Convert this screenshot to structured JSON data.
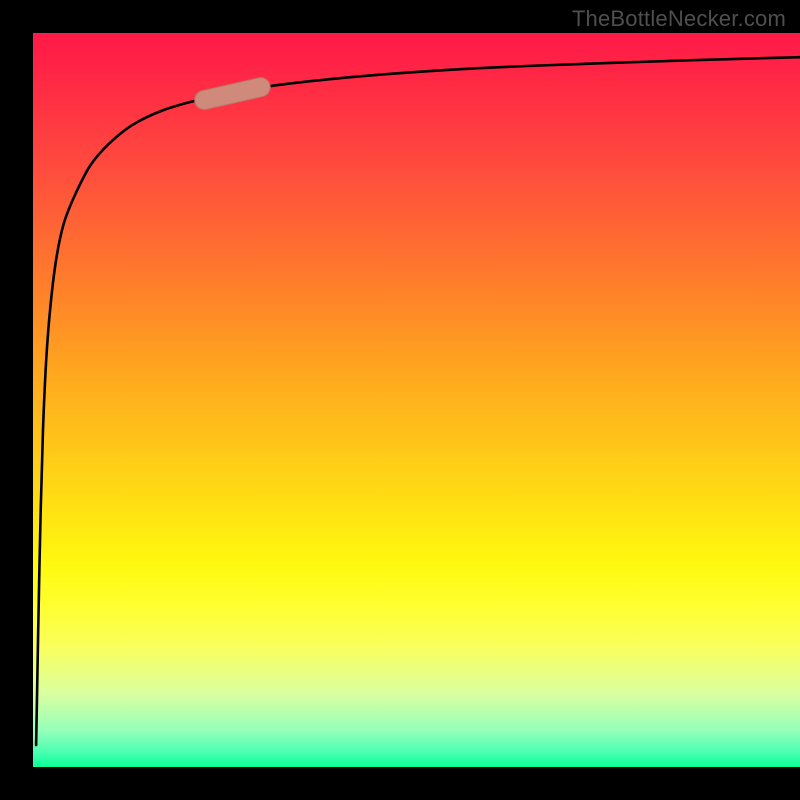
{
  "watermark": "TheBottleNecker.com",
  "colors": {
    "frame": "#000000",
    "curve": "#000000",
    "highlight_fill": "#cf8a7c",
    "highlight_stroke": "#b97768",
    "watermark_text": "#4f4f4f"
  },
  "chart_data": {
    "type": "line",
    "title": "",
    "xlabel": "",
    "ylabel": "",
    "xlim": [
      0,
      100
    ],
    "ylim": [
      0,
      100
    ],
    "series": [
      {
        "name": "bottleneck-curve",
        "x": [
          0.4,
          0.5,
          0.7,
          1.0,
          1.3,
          1.7,
          2.2,
          3.0,
          4.0,
          5.5,
          7.5,
          10,
          13,
          17,
          22,
          28,
          35,
          45,
          58,
          72,
          86,
          100
        ],
        "y": [
          3,
          8,
          20,
          35,
          46,
          55,
          62,
          69,
          74,
          78,
          82,
          85,
          87.5,
          89.5,
          91,
          92.3,
          93.3,
          94.3,
          95.2,
          95.8,
          96.3,
          96.7
        ]
      }
    ],
    "annotations": [
      {
        "name": "highlight-segment",
        "type": "pill",
        "x_range": [
          22,
          30
        ],
        "y_range": [
          90.8,
          92.7
        ]
      }
    ],
    "background_gradient": {
      "direction": "top_to_bottom",
      "stops": [
        {
          "pos": 0.0,
          "color": "#ff1a48"
        },
        {
          "pos": 0.33,
          "color": "#ff7a2c"
        },
        {
          "pos": 0.6,
          "color": "#ffd216"
        },
        {
          "pos": 0.78,
          "color": "#ffff30"
        },
        {
          "pos": 0.95,
          "color": "#96ffba"
        },
        {
          "pos": 1.0,
          "color": "#08ff98"
        }
      ]
    }
  }
}
